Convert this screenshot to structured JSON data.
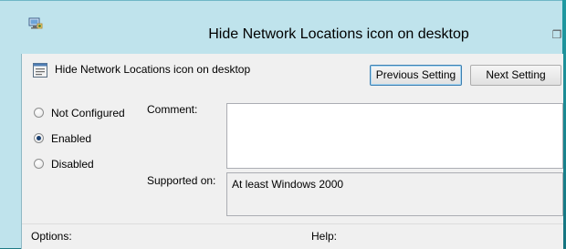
{
  "window": {
    "title": "Hide Network Locations icon on desktop"
  },
  "header": {
    "policy_name": "Hide Network Locations icon on desktop"
  },
  "buttons": {
    "previous_label": "Previous Setting",
    "next_label": "Next Setting"
  },
  "state": {
    "options": [
      {
        "label": "Not Configured",
        "checked": false
      },
      {
        "label": "Enabled",
        "checked": true
      },
      {
        "label": "Disabled",
        "checked": false
      }
    ]
  },
  "fields": {
    "comment_label": "Comment:",
    "comment_value": "",
    "supported_label": "Supported on:",
    "supported_value": "At least Windows 2000"
  },
  "sections": {
    "options_label": "Options:",
    "help_label": "Help:"
  },
  "colors": {
    "title_bar": "#bfe3ec",
    "desktop": "#1d7a84",
    "client": "#f0f0f0"
  }
}
